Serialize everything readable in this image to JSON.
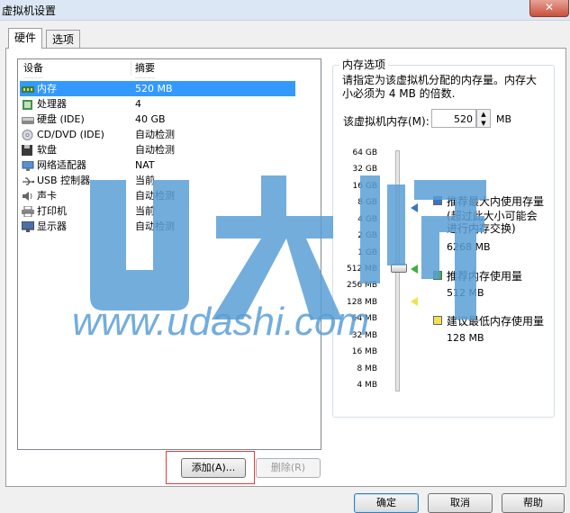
{
  "window": {
    "title": "虚拟机设置",
    "close_glyph": "✕"
  },
  "tabs": [
    {
      "label": "硬件",
      "active": true
    },
    {
      "label": "选项",
      "active": false
    }
  ],
  "device_list": {
    "col_device": "设备",
    "col_summary": "摘要",
    "rows": [
      {
        "name": "内存",
        "summary": "520 MB",
        "icon": "memory-icon",
        "selected": true
      },
      {
        "name": "处理器",
        "summary": "4",
        "icon": "processor-icon"
      },
      {
        "name": "硬盘 (IDE)",
        "summary": "40 GB",
        "icon": "hard-disk-icon"
      },
      {
        "name": "CD/DVD (IDE)",
        "summary": "自动检测",
        "icon": "cd-dvd-icon"
      },
      {
        "name": "软盘",
        "summary": "自动检测",
        "icon": "floppy-icon"
      },
      {
        "name": "网络适配器",
        "summary": "NAT",
        "icon": "network-adapter-icon"
      },
      {
        "name": "USB 控制器",
        "summary": "当前",
        "icon": "usb-icon"
      },
      {
        "name": "声卡",
        "summary": "自动检测",
        "icon": "sound-card-icon"
      },
      {
        "name": "打印机",
        "summary": "当前",
        "icon": "printer-icon"
      },
      {
        "name": "显示器",
        "summary": "自动检测",
        "icon": "display-icon"
      }
    ]
  },
  "buttons": {
    "add": "添加(A)...",
    "remove": "删除(R)",
    "ok": "确定",
    "cancel": "取消",
    "help": "帮助"
  },
  "memory": {
    "group_title": "内存选项",
    "description": "请指定为该虚拟机分配的内存量。内存大小必须为 4 MB 的倍数.",
    "label": "该虚拟机内存(M):",
    "value": "520",
    "unit": "MB",
    "ticks": [
      "64 GB",
      "32 GB",
      "16 GB",
      "8 GB",
      "4 GB",
      "2 GB",
      "1 GB",
      "512 MB",
      "256 MB",
      "128 MB",
      "64 MB",
      "32 MB",
      "16 MB",
      "8 MB",
      "4 MB"
    ],
    "legend": [
      {
        "title": "推荐最大内使用存量",
        "note": "(超过此大小可能会进行内存交换)",
        "value": "6268 MB",
        "color": "#3b74c4"
      },
      {
        "title": "推荐内存使用量",
        "value": "512 MB",
        "color": "#3cb043"
      },
      {
        "title": "建议最低内存使用量",
        "value": "128 MB",
        "color": "#f2e24a"
      }
    ]
  },
  "watermark": {
    "logo": "U大师",
    "url": "www.udashi.com"
  }
}
